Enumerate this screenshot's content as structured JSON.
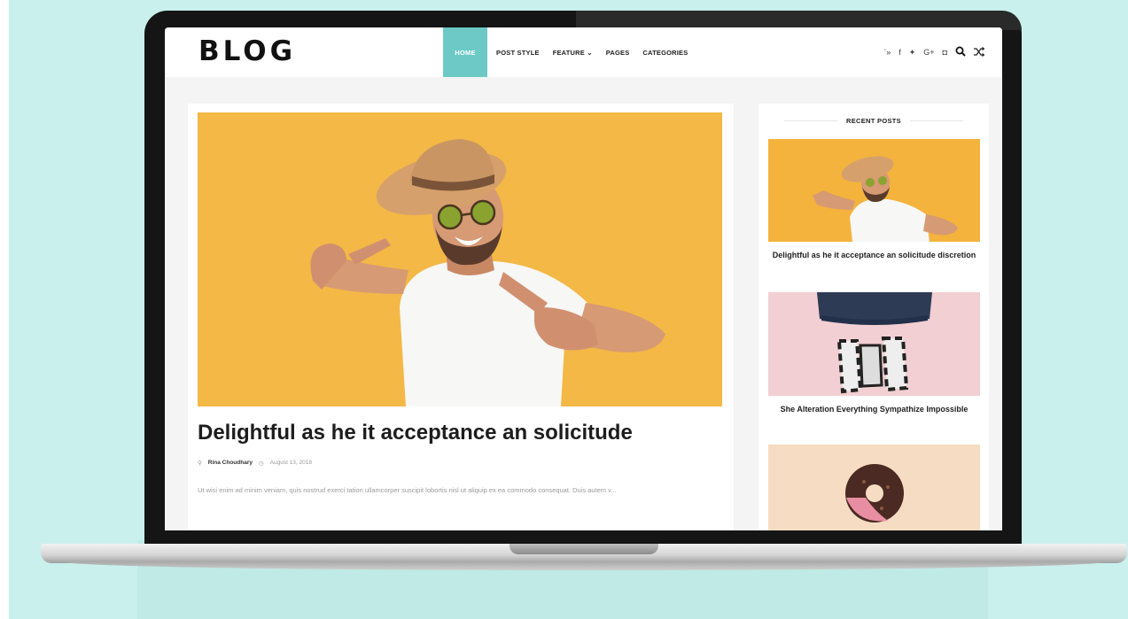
{
  "header": {
    "logo": "BLOG",
    "nav": [
      {
        "label": "HOME",
        "active": true
      },
      {
        "label": "POST STYLE",
        "active": false
      },
      {
        "label": "FEATURE ⌄",
        "active": false
      },
      {
        "label": "PAGES",
        "active": false
      },
      {
        "label": "CATEGORIES",
        "active": false
      }
    ],
    "social_icons": [
      "rss-icon",
      "facebook-icon",
      "twitter-icon",
      "google-plus-icon",
      "instagram-icon",
      "search-icon",
      "shuffle-icon"
    ]
  },
  "featured_post": {
    "title": "Delightful as he it acceptance an solicitude",
    "author": "Rina Choudhary",
    "date": "August 13, 2018",
    "excerpt": "Ut wisi enim ad minim veniam, quis nostrud exerci tation ullamcorper suscipit lobortis nisl ut aliquip ex ea commodo consequat. Duis autem v..."
  },
  "sidebar": {
    "heading": "RECENT POSTS",
    "posts": [
      {
        "title": "Delightful as he it acceptance an solicitude discretion"
      },
      {
        "title": "She Alteration Everything Sympathize Impossible"
      },
      {
        "title": ""
      }
    ]
  },
  "colors": {
    "accent": "#6cc9c6",
    "background_mint": "#c9f0ec",
    "hero_yellow": "#f3b33d",
    "card_pink": "#f2cfd2",
    "card_peach": "#f6dcc2"
  }
}
